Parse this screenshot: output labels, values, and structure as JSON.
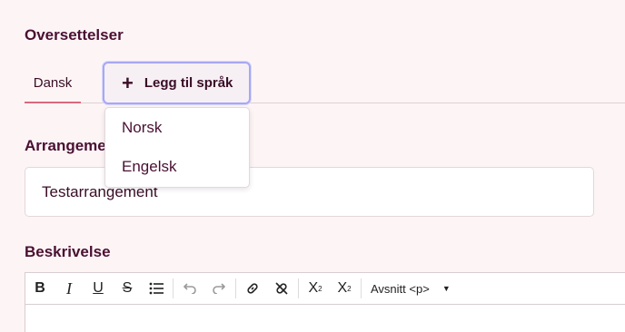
{
  "section_title": "Oversettelser",
  "tabs": [
    {
      "label": "Dansk",
      "active": true
    }
  ],
  "add_language": {
    "icon": "plus-icon",
    "label": "Legg til språk"
  },
  "language_options": [
    "Norsk",
    "Engelsk"
  ],
  "event_name": {
    "label": "Arrangementsnavn",
    "value": "Testarrangement"
  },
  "description": {
    "label": "Beskrivelse"
  },
  "editor_toolbar": {
    "format_label": "Avsnitt <p>",
    "buttons": [
      "bold-icon",
      "italic-icon",
      "underline-icon",
      "strikethrough-icon",
      "bullet-list-icon",
      "undo-icon",
      "redo-icon",
      "link-icon",
      "unlink-icon",
      "subscript-icon",
      "superscript-icon"
    ]
  },
  "colors": {
    "text": "#4a1033",
    "accent": "#d96a80",
    "focus": "#a7a7f4",
    "background": "#fdf5f5"
  }
}
